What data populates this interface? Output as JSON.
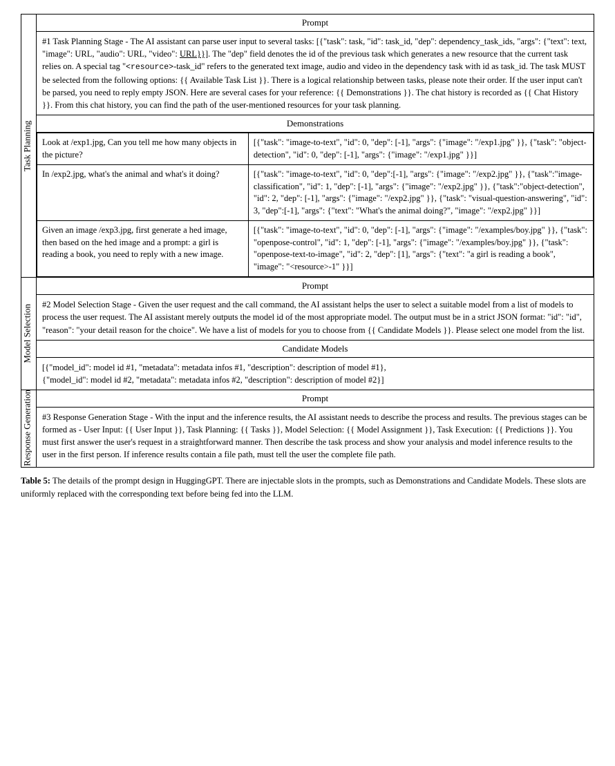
{
  "table": {
    "sections": [
      {
        "label": "Task Planning",
        "prompt_header": "Prompt",
        "prompt_body": "#1 Task Planning Stage - The AI assistant can parse user input to several tasks: [{\"task\": task, \"id\": task_id, \"dep\": dependency_task_ids, \"args\": {\"text\": text, \"image\": URL, \"audio\": URL, \"video\": URL}}]. The \"dep\" field denotes the id of the previous task which generates a new resource that the current task relies on. A special tag \"<resource>-task_id\" refers to the generated text image, audio and video in the dependency task with id as task_id. The task MUST be selected from the following options: {{ Available Task List }}. There is a logical relationship between tasks, please note their order. If the user input can't be parsed, you need to reply empty JSON. Here are several cases for your reference: {{ Demonstrations }}. The chat history is recorded as {{ Chat History }}. From this chat history, you can find the path of the user-mentioned resources for your task planning.",
        "demonstrations_header": "Demonstrations",
        "demos": [
          {
            "input": "Look at /exp1.jpg, Can you tell me how many objects in the picture?",
            "output": "[{\"task\": \"image-to-text\", \"id\": 0, \"dep\": [-1], \"args\": {\"image\": \"/exp1.jpg\" }}, {\"task\": \"object-detection\", \"id\": 0, \"dep\": [-1], \"args\": {\"image\": \"/exp1.jpg\" }}]"
          },
          {
            "input": "In /exp2.jpg, what's the animal and what's it doing?",
            "output": "[{\"task\": \"image-to-text\", \"id\": 0, \"dep\":[-1], \"args\": {\"image\": \"/exp2.jpg\" }}, {\"task\":\"image-classification\", \"id\": 1, \"dep\": [-1], \"args\": {\"image\": \"/exp2.jpg\" }}, {\"task\":\"object-detection\", \"id\": 2, \"dep\": [-1], \"args\": {\"image\": \"/exp2.jpg\" }}, {\"task\": \"visual-question-answering\", \"id\": 3, \"dep\":[- 1], \"args\": {\"text\": \"What's the animal doing?\", \"image\": \"/exp2.jpg\" }}]"
          },
          {
            "input": "Given an image /exp3.jpg, first generate a hed image, then based on the hed image and a prompt: a girl is reading a book, you need to reply with a new image.",
            "output": "[{\"task\": \"image-to-text\", \"id\": 0, \"dep\": [-1], \"args\": {\"image\": \"/examples/boy.jpg\" }}, {\"task\": \"openpose-control\", \"id\": 1, \"dep\": [-1], \"args\": {\"image\": \"/examples/boy.jpg\" }}, {\"task\": \"openpose-text-to-image\", \"id\": 2, \"dep\": [1], \"args\": {\"text\": \"a girl is reading a book\", \"image\": \"<resource>-1\" }}]"
          }
        ]
      },
      {
        "label": "Model Selection",
        "prompt_header": "Prompt",
        "prompt_body": "#2 Model Selection Stage - Given the user request and the call command, the AI assistant helps the user to select a suitable model from a list of models to process the user request. The AI assistant merely outputs the model id of the most appropriate model. The output must be in a strict JSON format: \"id\": \"id\", \"reason\": \"your detail reason for the choice\". We have a list of models for you to choose from {{ Candidate Models }}. Please select one model from the list.",
        "candidates_header": "Candidate Models",
        "candidates_body": "[{\"model_id\": model id #1, \"metadata\": metadata infos #1, \"description\": description of model #1},\n{\"model_id\": model id #2, \"metadata\": metadata infos #2, \"description\": description of model #2}]"
      },
      {
        "label": "Response Generation",
        "prompt_header": "Prompt",
        "prompt_body": "#3 Response Generation Stage - With the input and the inference results, the AI assistant needs to describe the process and results. The previous stages can be formed as - User Input: {{ User Input }}, Task Planning: {{ Tasks }}, Model Selection: {{ Model Assignment }}, Task Execution: {{ Predictions }}. You must first answer the user's request in a straightforward manner. Then describe the task process and show your analysis and model inference results to the user in the first person. If inference results contain a file path, must tell the user the complete file path."
      }
    ],
    "caption_bold": "Table 5:",
    "caption_text": " The details of the prompt design in HuggingGPT. There are injectable slots in the prompts, such as Demonstrations and Candidate Models. These slots are uniformly replaced with the corresponding text before being fed into the LLM."
  }
}
